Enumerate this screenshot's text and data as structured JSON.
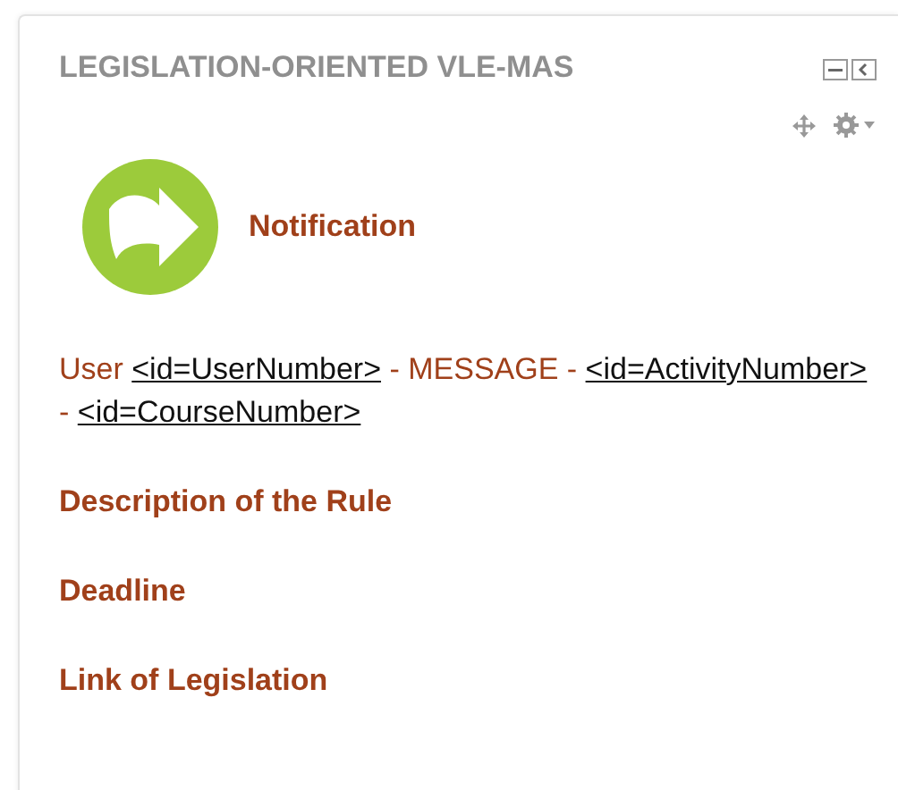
{
  "block": {
    "title": "LEGISLATION-ORIENTED VLE-MAS"
  },
  "notification": {
    "title": "Notification"
  },
  "message": [
    {
      "kind": "text",
      "text": "User "
    },
    {
      "kind": "link",
      "text": "<id=UserNumber>"
    },
    {
      "kind": "text",
      "text": " - MESSAGE - "
    },
    {
      "kind": "link",
      "text": "<id=ActivityNumber>"
    },
    {
      "kind": "text",
      "text": " - "
    },
    {
      "kind": "link",
      "text": "<id=CourseNumber>"
    }
  ],
  "sections": [
    "Description of the Rule",
    "Deadline",
    "Link of Legislation"
  ]
}
